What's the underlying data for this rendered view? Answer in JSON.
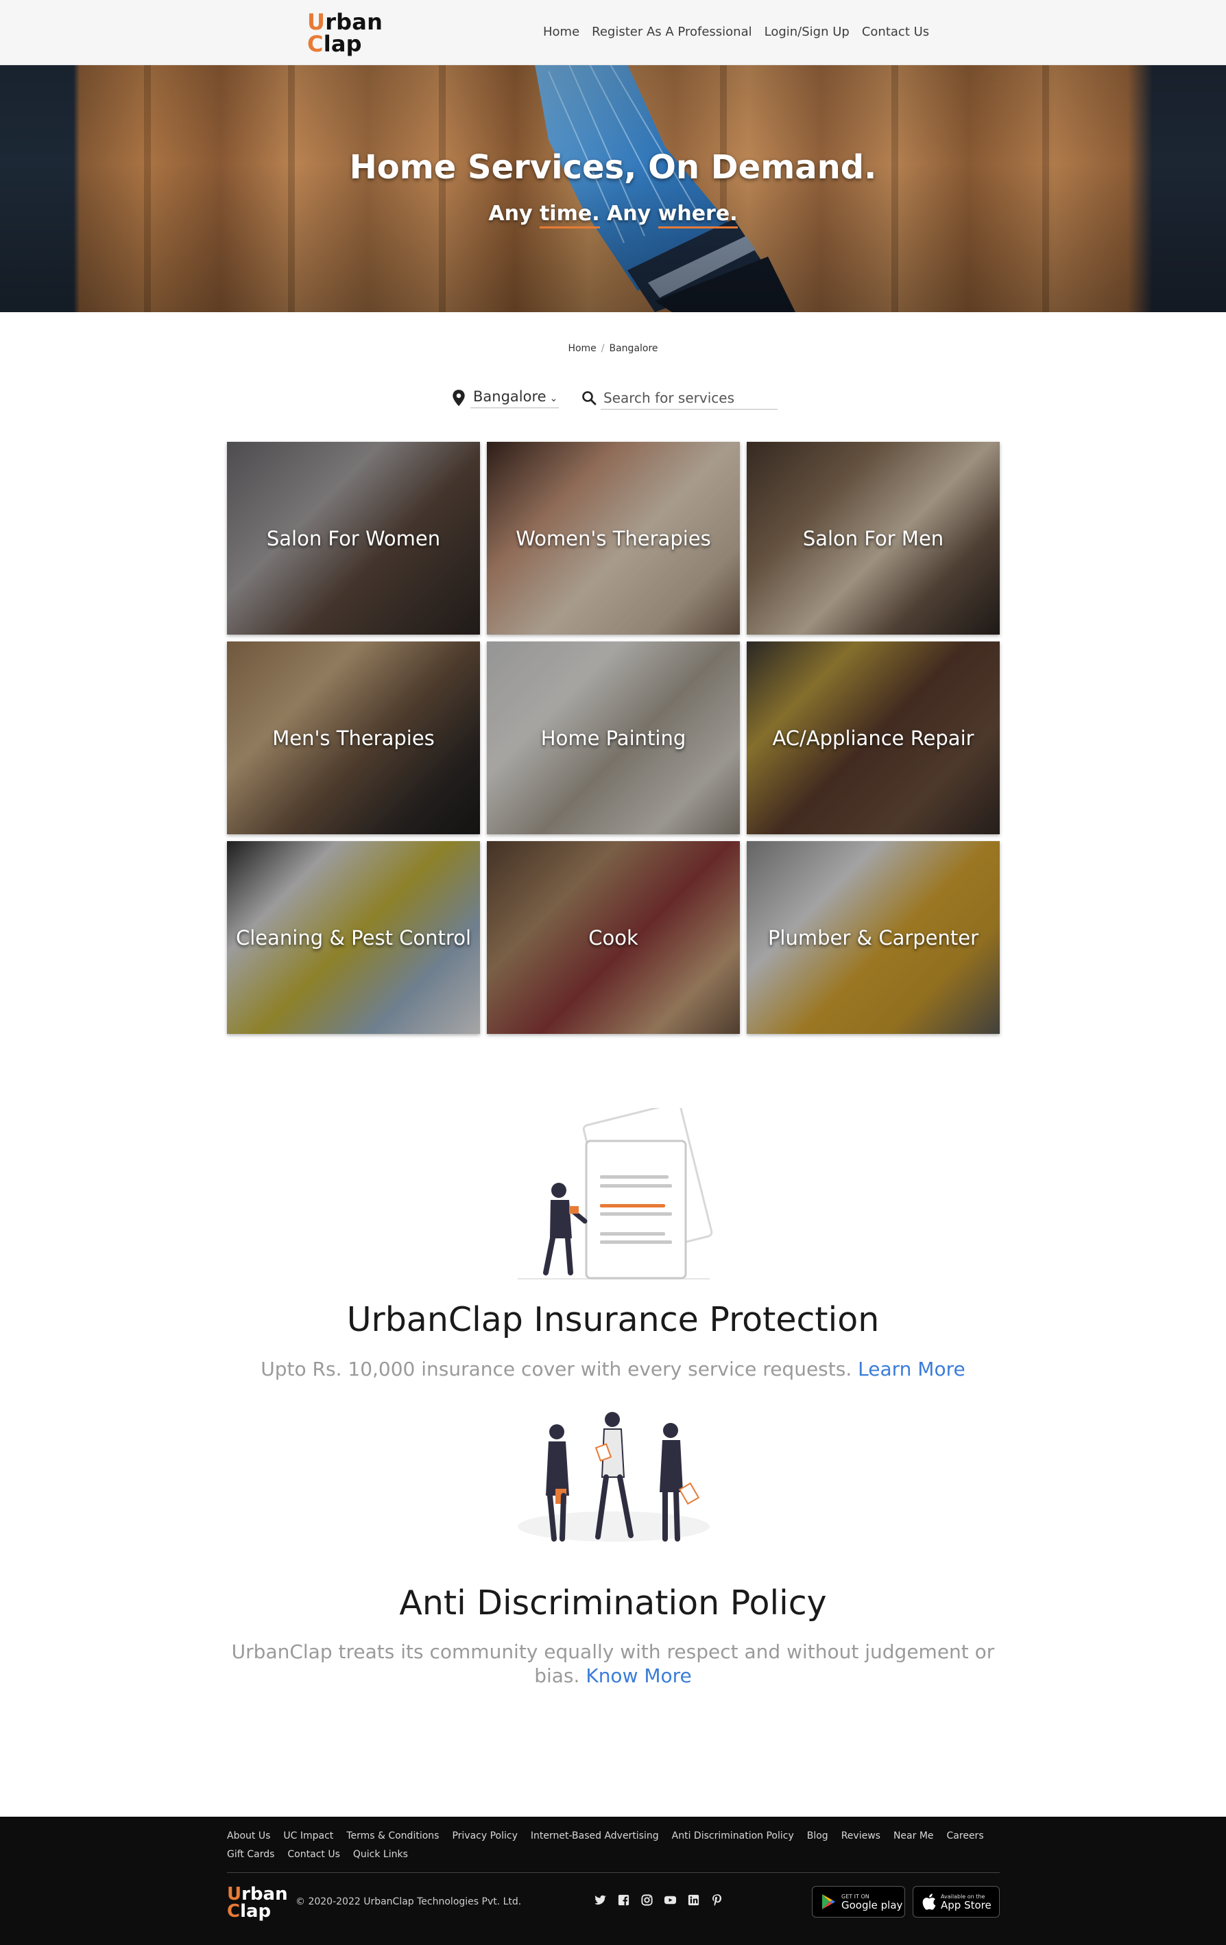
{
  "brand": {
    "line1_accent": "U",
    "line1_rest": "rban",
    "line2_accent": "C",
    "line2_rest": "lap",
    "accent_color": "#e77b36"
  },
  "nav": {
    "items": [
      "Home",
      "Register As A Professional",
      "Login/Sign Up",
      "Contact Us"
    ]
  },
  "hero": {
    "title": "Home Services, On Demand.",
    "sub_part1": "Any ",
    "sub_under1": "time.",
    "sub_part2": " Any ",
    "sub_under2": "where."
  },
  "breadcrumb": {
    "items": [
      "Home",
      "Bangalore"
    ],
    "separator": "/"
  },
  "location": {
    "city": "Bangalore"
  },
  "search": {
    "placeholder": "Search for services",
    "value": ""
  },
  "services": [
    {
      "label": "Salon For Women"
    },
    {
      "label": "Women's Therapies"
    },
    {
      "label": "Salon For Men"
    },
    {
      "label": "Men's Therapies"
    },
    {
      "label": "Home Painting"
    },
    {
      "label": "AC/Appliance Repair"
    },
    {
      "label": "Cleaning & Pest Control"
    },
    {
      "label": "Cook"
    },
    {
      "label": "Plumber & Carpenter"
    }
  ],
  "insurance": {
    "title": "UrbanClap Insurance Protection",
    "text": "Upto Rs. 10,000 insurance cover with every service requests.",
    "link": "Learn More"
  },
  "anti_discrimination": {
    "title": "Anti Discrimination Policy",
    "text": "UrbanClap treats its community equally with respect and without judgement or bias.",
    "link": "Know More"
  },
  "footer": {
    "links": [
      "About Us",
      "UC Impact",
      "Terms & Conditions",
      "Privacy Policy",
      "Internet-Based Advertising",
      "Anti Discrimination Policy",
      "Blog",
      "Reviews",
      "Near Me",
      "Careers",
      "Gift Cards",
      "Contact Us",
      "Quick Links"
    ],
    "copyright": "© 2020-2022 UrbanClap Technologies Pvt. Ltd.",
    "social_icons": [
      "twitter-icon",
      "facebook-icon",
      "instagram-icon",
      "youtube-icon",
      "linkedin-icon",
      "pinterest-icon"
    ],
    "google_play": {
      "small": "GET IT ON",
      "big": "Google play"
    },
    "app_store": {
      "small": "Available on the",
      "big": "App Store"
    }
  }
}
